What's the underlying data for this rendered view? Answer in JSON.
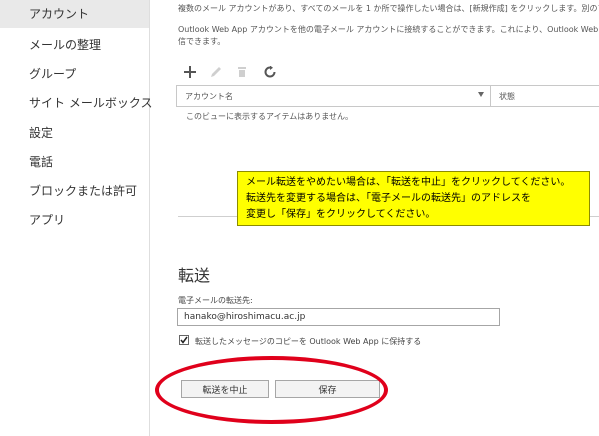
{
  "sidebar": {
    "items": [
      {
        "label": "アカウント",
        "active": true
      },
      {
        "label": "メールの整理"
      },
      {
        "label": "グループ"
      },
      {
        "label": "サイト メールボックス"
      },
      {
        "label": "設定"
      },
      {
        "label": "電話"
      },
      {
        "label": "ブロックまたは許可"
      },
      {
        "label": "アプリ"
      }
    ]
  },
  "accounts": {
    "intro_line1": "複数のメール アカウントがあり、すべてのメールを 1 か所で操作したい場合は、[新規作成] をクリックします。別のアカウ",
    "intro_line2": "Outlook Web App アカウントを他の電子メール アカウントに接続することができます。これにより、Outlook Web App",
    "intro_line3": "信できます。",
    "toolbar": {
      "add_icon": "plus-icon",
      "edit_icon": "pencil-icon",
      "delete_icon": "trash-icon",
      "refresh_icon": "refresh-icon"
    },
    "columns": {
      "name": "アカウント名",
      "status": "状態"
    },
    "empty_message": "このビューに表示するアイテムはありません。"
  },
  "callout": {
    "line1": "メール転送をやめたい場合は、「転送を中止」をクリックしてください。",
    "line2": "転送先を変更する場合は、「電子メールの転送先」のアドレスを",
    "line3": "変更し「保存」をクリックしてください。",
    "background": "#ffff00"
  },
  "forwarding": {
    "title": "転送",
    "field_label": "電子メールの転送先:",
    "field_value": "hanako@hiroshimacu.ac.jp",
    "keep_copy_label": "転送したメッセージのコピーを Outlook Web App に保持する",
    "keep_copy_checked": true,
    "stop_button": "転送を中止",
    "save_button": "保存"
  },
  "colors": {
    "highlight_ellipse": "#e0001b",
    "active_nav": "#e9e9e9"
  }
}
